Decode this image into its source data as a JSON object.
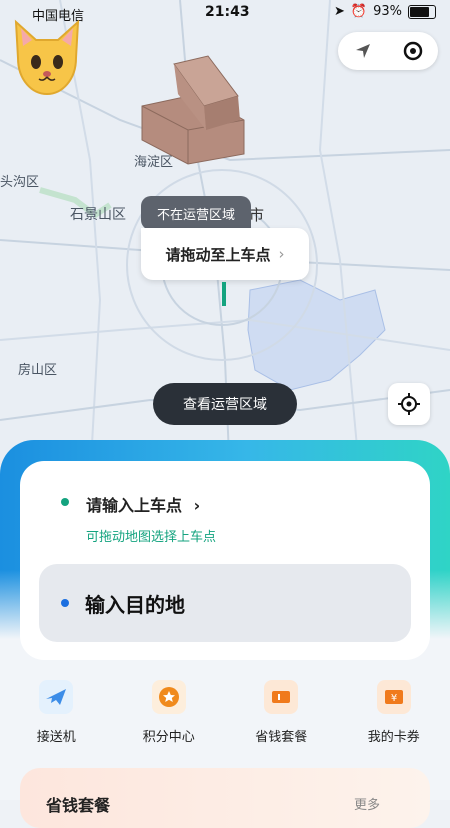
{
  "status_bar": {
    "carrier": "中国电信",
    "time": "21:43",
    "battery": "93%"
  },
  "map": {
    "labels": {
      "haidian": "海淀区",
      "mentougou": "头沟区",
      "shijingshan": "石景山区",
      "fangshan": "房山区",
      "city_suffix": "市"
    },
    "not_in_service_tag": "不在运营区域",
    "drag_prompt": "请拖动至上车点",
    "view_area_button": "查看运营区域"
  },
  "trip_card": {
    "pickup_label": "请输入上车点",
    "pickup_hint": "可拖动地图选择上车点",
    "destination_label": "输入目的地"
  },
  "services": [
    {
      "label": "接送机",
      "icon": "airplane-icon"
    },
    {
      "label": "积分中心",
      "icon": "points-coin-icon"
    },
    {
      "label": "省钱套餐",
      "icon": "ticket-icon"
    },
    {
      "label": "我的卡券",
      "icon": "coupon-yen-icon"
    }
  ],
  "promo_card": {
    "title": "省钱套餐",
    "more": "更多"
  },
  "colors": {
    "accent_green": "#14a37f",
    "accent_blue": "#1b6fe0",
    "dark_button": "#2a3038"
  }
}
